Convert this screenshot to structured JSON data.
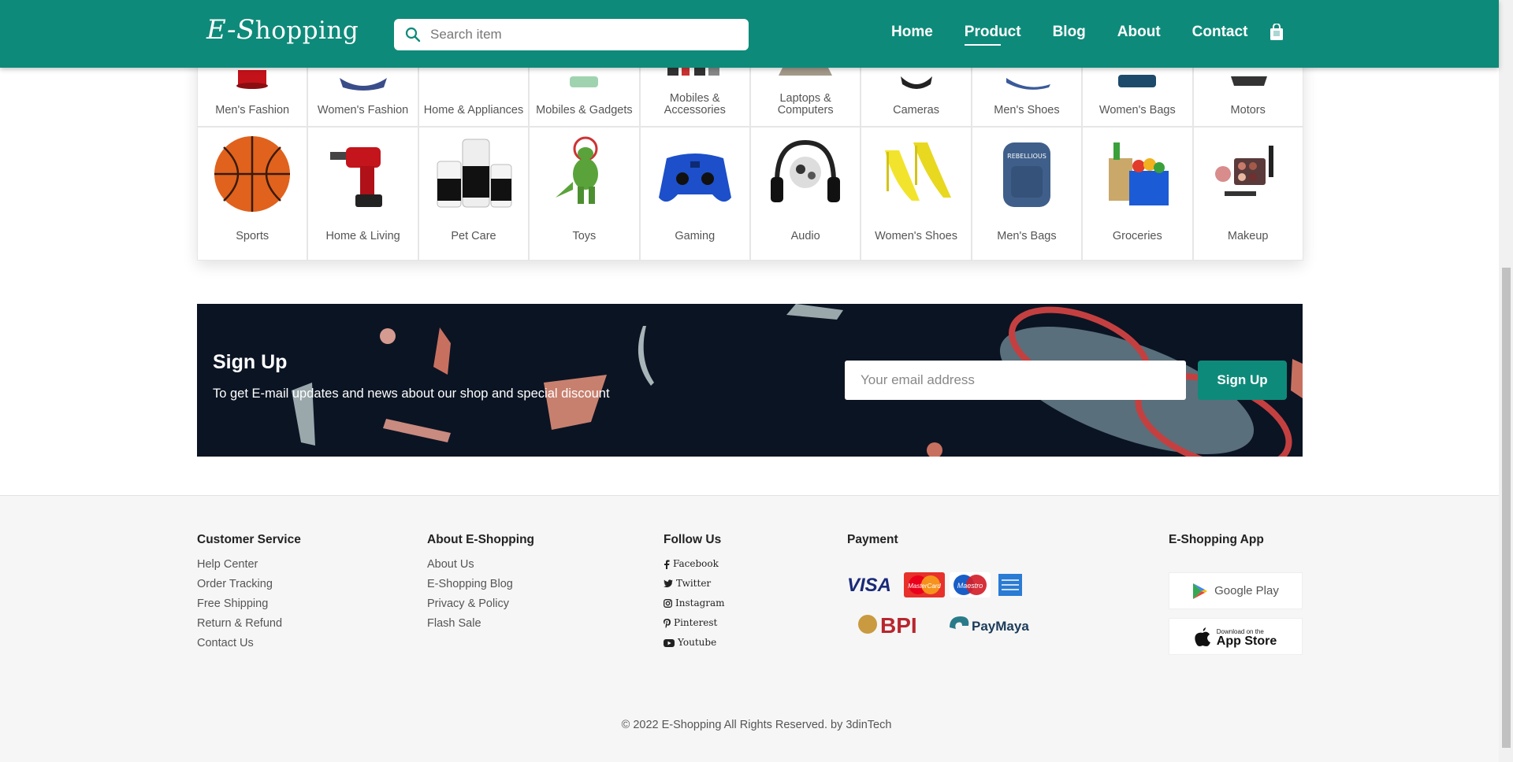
{
  "header": {
    "logo_script": "E-S",
    "logo_rest": "hopping",
    "search_placeholder": "Search item",
    "nav": [
      "Home",
      "Product",
      "Blog",
      "About",
      "Contact"
    ],
    "active_nav": "Product",
    "bag_icon": "shopping-bag-icon"
  },
  "categories_row1": [
    "Men's Fashion",
    "Women's Fashion",
    "Home & Appliances",
    "Mobiles & Gadgets",
    "Mobiles & Accessories",
    "Laptops & Computers",
    "Cameras",
    "Men's Shoes",
    "Women's Bags",
    "Motors"
  ],
  "categories_row2": [
    "Sports",
    "Home & Living",
    "Pet Care",
    "Toys",
    "Gaming",
    "Audio",
    "Women's Shoes",
    "Men's Bags",
    "Groceries",
    "Makeup"
  ],
  "signup": {
    "title": "Sign Up",
    "subtitle": "To get E-mail updates and news about our shop and special discount",
    "email_placeholder": "Your email address",
    "button": "Sign Up"
  },
  "footer": {
    "customer_service": {
      "title": "Customer Service",
      "links": [
        "Help Center",
        "Order Tracking",
        "Free Shipping",
        "Return & Refund",
        "Contact Us"
      ]
    },
    "about": {
      "title": "About E-Shopping",
      "links": [
        "About Us",
        "E-Shopping Blog",
        "Privacy & Policy",
        "Flash Sale"
      ]
    },
    "follow": {
      "title": "Follow Us",
      "links": [
        "Facebook",
        "Twitter",
        "Instagram",
        "Pinterest",
        "Youtube"
      ]
    },
    "payment": {
      "title": "Payment",
      "methods": [
        "VISA",
        "MasterCard",
        "Maestro",
        "AMEX",
        "BPI",
        "PayMaya"
      ]
    },
    "app": {
      "title": "E-Shopping App",
      "google_play": "Google Play",
      "app_store_small": "Download on the",
      "app_store": "App Store"
    },
    "copyright": "© 2022 E-Shopping All Rights Reserved. by 3dinTech"
  },
  "colors": {
    "brand": "#0e8a7a",
    "banner_bg": "#0b1423"
  }
}
